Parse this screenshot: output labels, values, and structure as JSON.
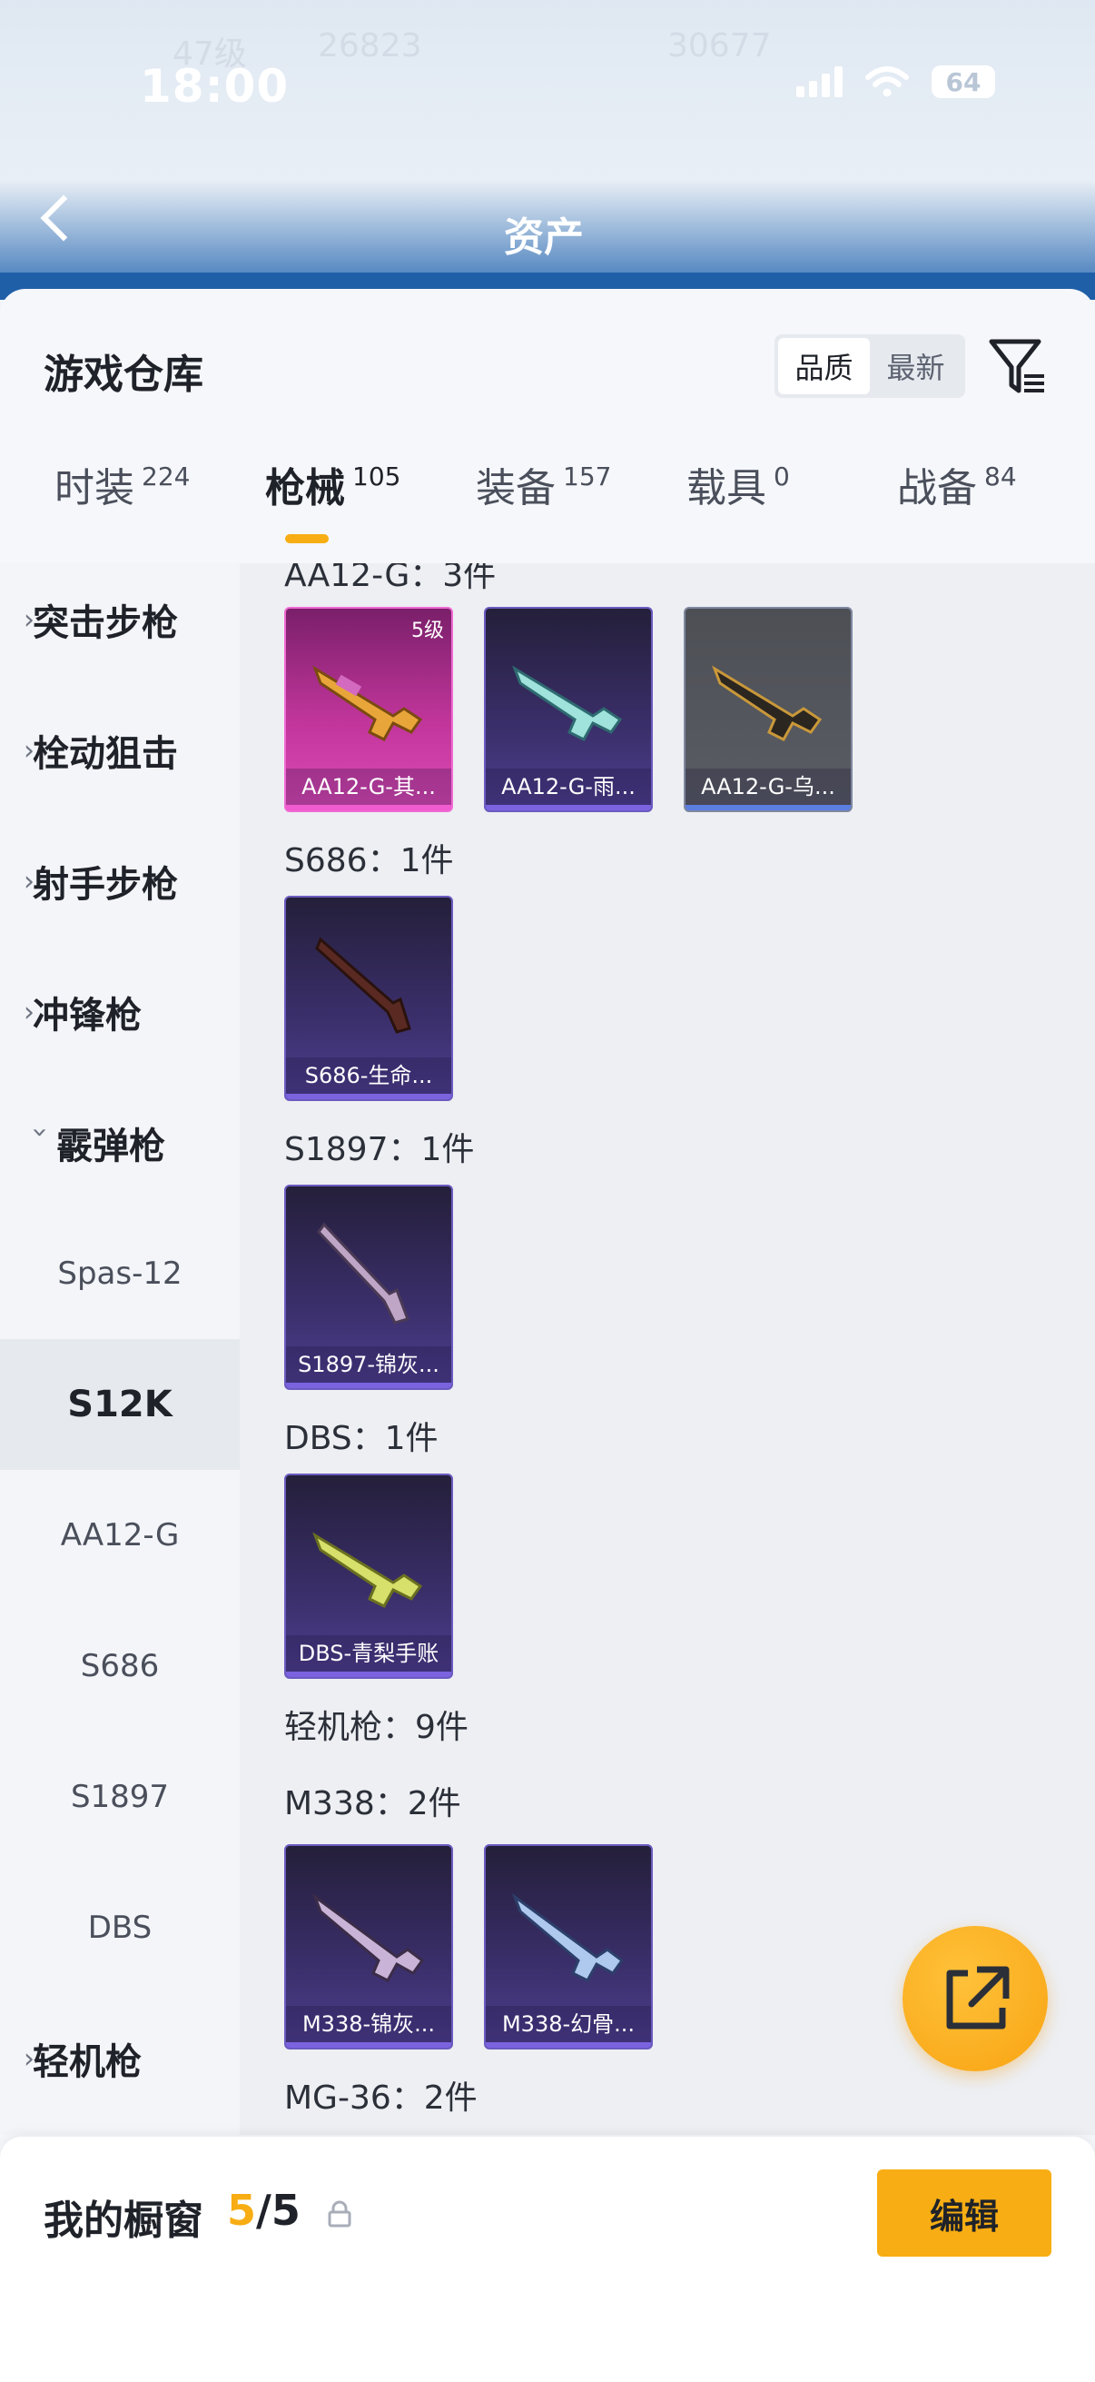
{
  "status_bar": {
    "time": "18:00",
    "battery": "64"
  },
  "header": {
    "title": "资产"
  },
  "sheet": {
    "title": "游戏仓库"
  },
  "sort": {
    "options": [
      "品质",
      "最新"
    ],
    "selected": "品质"
  },
  "tabs": [
    {
      "label": "时装",
      "count": "224"
    },
    {
      "label": "枪械",
      "count": "105",
      "active": true
    },
    {
      "label": "装备",
      "count": "157"
    },
    {
      "label": "载具",
      "count": "0"
    },
    {
      "label": "战备",
      "count": "84"
    }
  ],
  "sidebar": {
    "items": [
      {
        "label": "突击步枪",
        "type": "category"
      },
      {
        "label": "栓动狙击",
        "type": "category"
      },
      {
        "label": "射手步枪",
        "type": "category"
      },
      {
        "label": "冲锋枪",
        "type": "category"
      },
      {
        "label": "霰弹枪",
        "type": "category",
        "expanded": true
      },
      {
        "label": "Spas-12",
        "type": "sub"
      },
      {
        "label": "S12K",
        "type": "sub",
        "selected": true
      },
      {
        "label": "AA12-G",
        "type": "sub"
      },
      {
        "label": "S686",
        "type": "sub"
      },
      {
        "label": "S1897",
        "type": "sub"
      },
      {
        "label": "DBS",
        "type": "sub"
      },
      {
        "label": "轻机枪",
        "type": "category"
      }
    ]
  },
  "content": {
    "sections": [
      {
        "label": "AA12-G：3件"
      },
      {
        "label": "S686：1件"
      },
      {
        "label": "S1897：1件"
      },
      {
        "label": "DBS：1件"
      },
      {
        "label": "轻机枪：9件"
      },
      {
        "label": "M338：2件"
      },
      {
        "label": "MG-36：2件"
      }
    ],
    "cards": [
      {
        "name": "AA12-G-其...",
        "badge": "5级",
        "rarity": "pink"
      },
      {
        "name": "AA12-G-雨...",
        "rarity": "purple"
      },
      {
        "name": "AA12-G-乌...",
        "rarity": "gray"
      },
      {
        "name": "S686-生命...",
        "rarity": "purple"
      },
      {
        "name": "S1897-锦灰...",
        "rarity": "purple"
      },
      {
        "name": "DBS-青梨手账",
        "rarity": "purple"
      },
      {
        "name": "M338-锦灰...",
        "rarity": "purple"
      },
      {
        "name": "M338-幻骨...",
        "rarity": "purple"
      }
    ]
  },
  "showcase": {
    "label": "我的橱窗",
    "current": "5",
    "separator": "/",
    "max": "5",
    "edit_label": "编辑"
  },
  "colors": {
    "accent": "#f7ad13",
    "rarity_pink": "#e04ab8",
    "rarity_purple": "#4f3f8f",
    "rarity_gray": "#5a5d64"
  }
}
